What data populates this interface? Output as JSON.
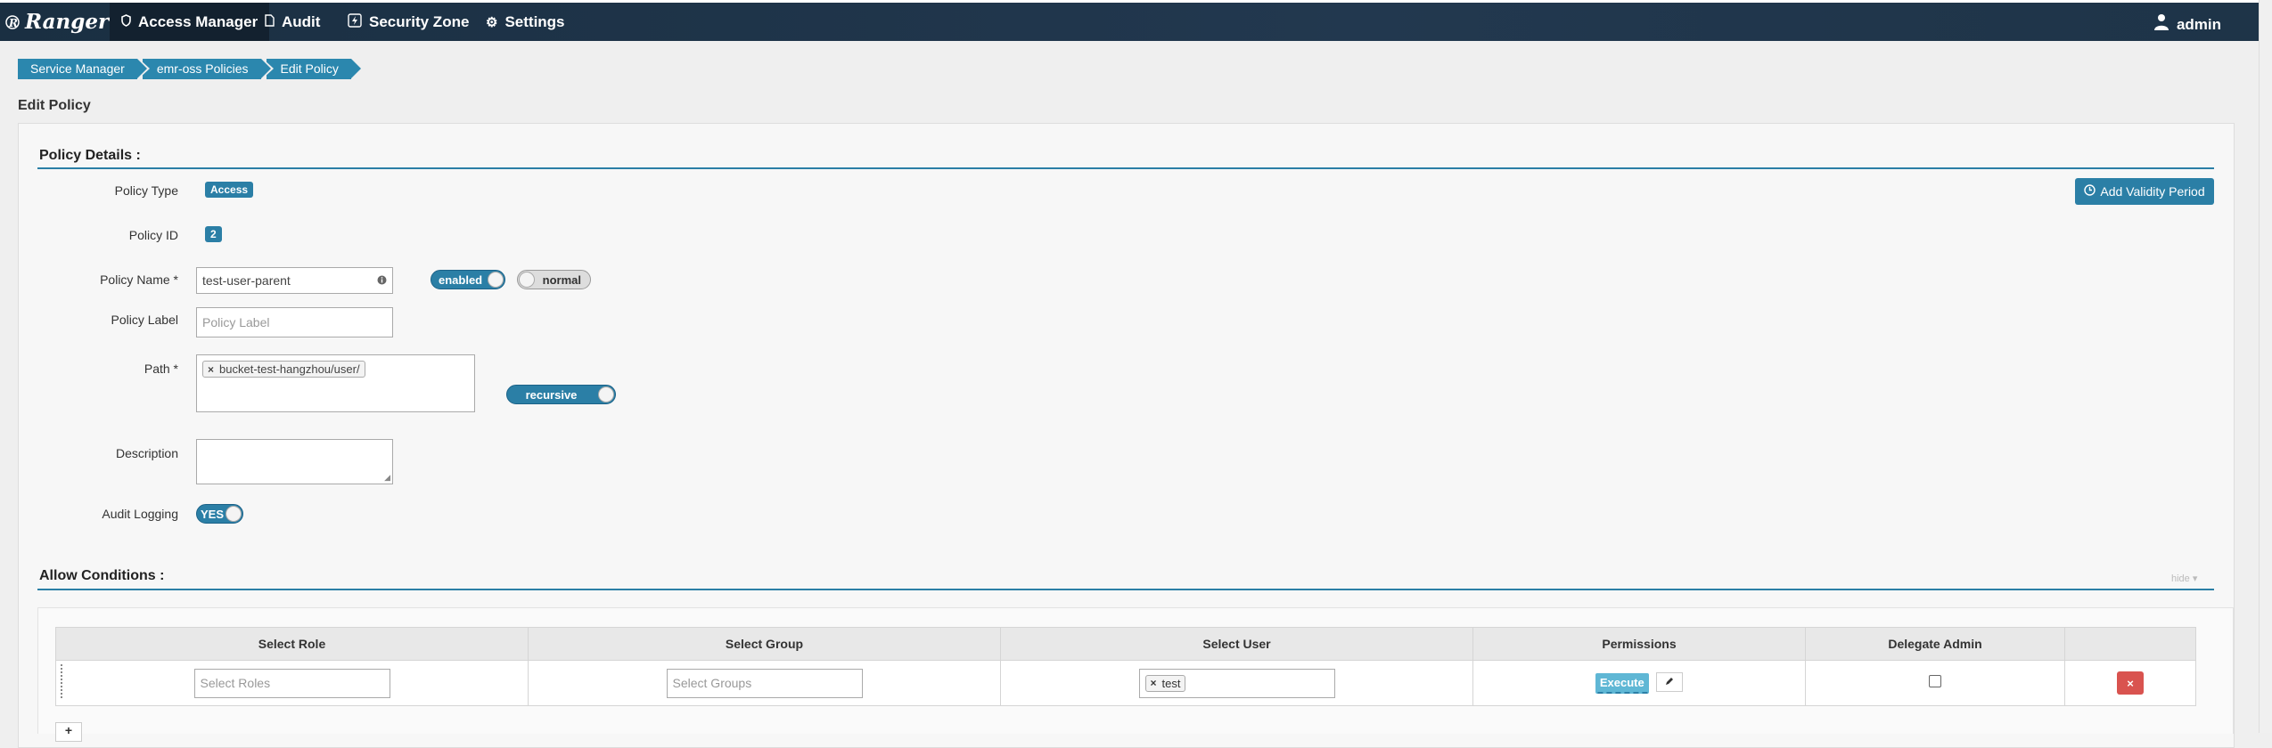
{
  "brand": "Ranger",
  "nav": {
    "access_manager": "Access Manager",
    "audit": "Audit",
    "security_zone": "Security Zone",
    "settings": "Settings",
    "user": "admin"
  },
  "breadcrumb": [
    "Service Manager",
    "emr-oss Policies",
    "Edit Policy"
  ],
  "page_title": "Edit Policy",
  "policy_details": {
    "title": "Policy Details :",
    "policy_type_label": "Policy Type",
    "policy_type_value": "Access",
    "policy_id_label": "Policy ID",
    "policy_id_value": "2",
    "policy_name_label": "Policy Name *",
    "policy_name_value": "test-user-parent",
    "policy_label_label": "Policy Label",
    "policy_label_placeholder": "Policy Label",
    "path_label": "Path *",
    "path_tag": "bucket-test-hangzhou/user/",
    "description_label": "Description",
    "audit_logging_label": "Audit Logging",
    "enabled_toggle": "enabled",
    "normal_toggle": "normal",
    "recursive_toggle": "recursive",
    "audit_toggle": "YES",
    "add_validity_button": "Add Validity Period"
  },
  "allow_conditions": {
    "title": "Allow Conditions :",
    "hide_link": "hide ▾",
    "columns": [
      "Select Role",
      "Select Group",
      "Select User",
      "Permissions",
      "Delegate Admin",
      ""
    ],
    "row": {
      "role_placeholder": "Select Roles",
      "group_placeholder": "Select Groups",
      "user_tag": "test",
      "permission": "Execute"
    },
    "add_button": "+"
  }
}
